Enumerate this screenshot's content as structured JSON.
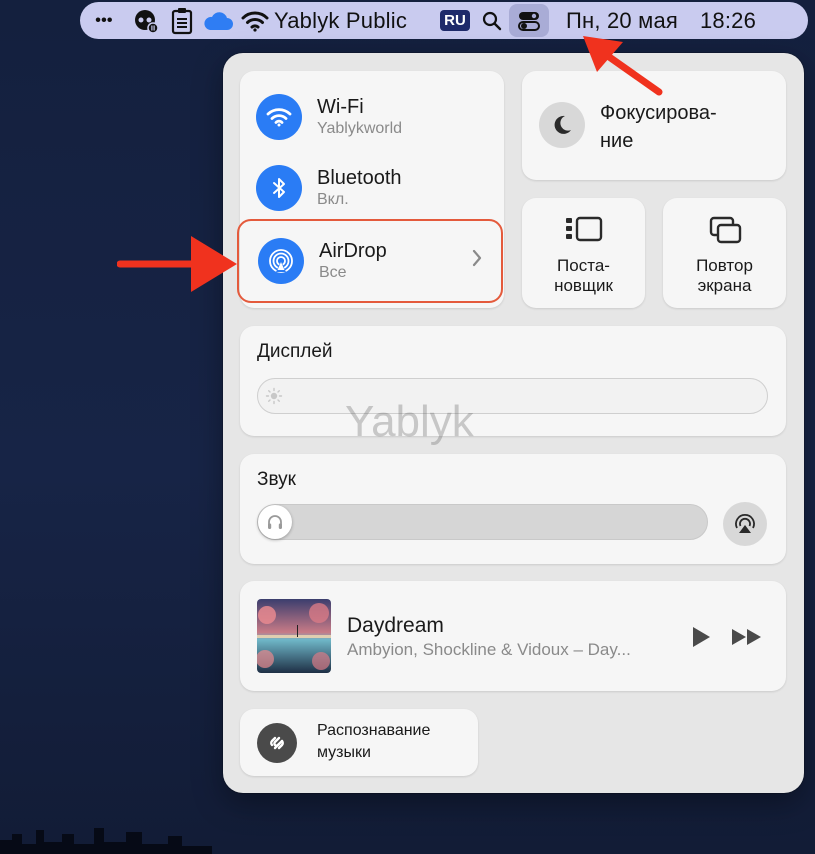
{
  "menubar": {
    "ellipsis": "•••",
    "network_name": "Yablyk Public",
    "input_language": "RU",
    "date": "Пн, 20 мая",
    "time": "18:26"
  },
  "control_center": {
    "connectivity": {
      "wifi": {
        "title": "Wi-Fi",
        "subtitle": "Yablykworld",
        "icon": "wifi-icon"
      },
      "bluetooth": {
        "title": "Bluetooth",
        "subtitle": "Вкл.",
        "icon": "bluetooth-icon"
      },
      "airdrop": {
        "title": "AirDrop",
        "subtitle": "Все",
        "icon": "airdrop-icon"
      }
    },
    "focus": {
      "label_line1": "Фокусирова-",
      "label_line2": "ние",
      "icon": "moon-icon"
    },
    "stage_manager": {
      "label_line1": "Поста-",
      "label_line2": "новщик",
      "icon": "stage-manager-icon"
    },
    "screen_mirroring": {
      "label_line1": "Повтор",
      "label_line2": "экрана",
      "icon": "screen-mirroring-icon"
    },
    "display": {
      "label": "Дисплей",
      "brightness": 0.0
    },
    "sound": {
      "label": "Звук",
      "volume": 0.0
    },
    "now_playing": {
      "title": "Daydream",
      "artist": "Ambyion, Shockline & Vidoux – Day..."
    },
    "music_recognition": {
      "label_line1": "Распознавание",
      "label_line2": "музыки",
      "icon": "shazam-icon"
    }
  },
  "watermark": "Yablyk",
  "colors": {
    "accent_blue": "#2a7cf5",
    "highlight_red": "#e45a3c",
    "annotation_arrow": "#f0321e"
  }
}
